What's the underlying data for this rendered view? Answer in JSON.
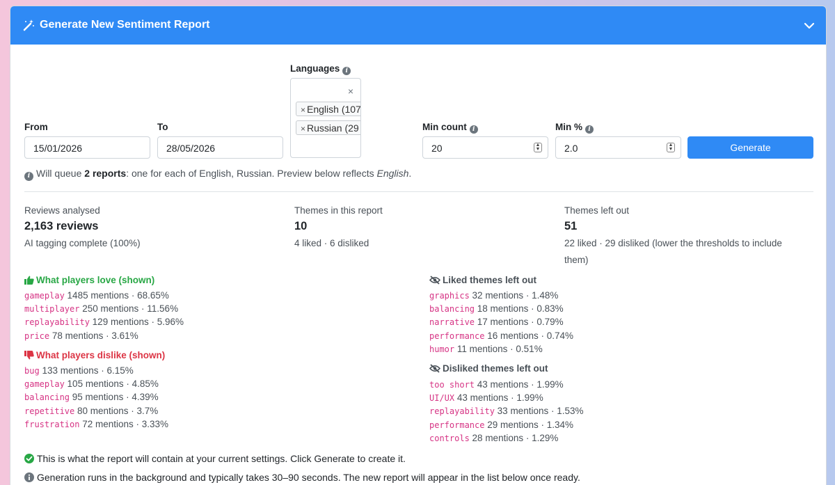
{
  "header": {
    "title": "Generate New Sentiment Report"
  },
  "form": {
    "from_label": "From",
    "from_value": "15/01/2026",
    "to_label": "To",
    "to_value": "28/05/2026",
    "languages_label": "Languages",
    "languages": [
      "English (107",
      "Russian (29"
    ],
    "min_count_label": "Min count",
    "min_count_value": "20",
    "min_pct_label": "Min %",
    "min_pct_value": "2.0",
    "generate_label": "Generate"
  },
  "queue_note": {
    "prefix": "Will queue ",
    "bold": "2 reports",
    "middle": ": one for each of English, Russian. Preview below reflects ",
    "italic": "English",
    "suffix": "."
  },
  "stats": {
    "reviews": {
      "label": "Reviews analysed",
      "value": "2,163 reviews",
      "sub": "AI tagging complete (100%)"
    },
    "themes": {
      "label": "Themes in this report",
      "value": "10",
      "sub": "4 liked · 6 disliked"
    },
    "left_out": {
      "label": "Themes left out",
      "value": "51",
      "sub": "22 liked · 29 disliked (lower the thresholds to include them)"
    }
  },
  "sections": {
    "love_title": "What players love (shown)",
    "love": [
      {
        "theme": "gameplay",
        "stats": " 1485 mentions · 68.65%"
      },
      {
        "theme": "multiplayer",
        "stats": " 250 mentions · 11.56%"
      },
      {
        "theme": "replayability",
        "stats": " 129 mentions · 5.96%"
      },
      {
        "theme": "price",
        "stats": " 78 mentions · 3.61%"
      }
    ],
    "dislike_title": "What players dislike (shown)",
    "dislike": [
      {
        "theme": "bug",
        "stats": " 133 mentions · 6.15%"
      },
      {
        "theme": "gameplay",
        "stats": " 105 mentions · 4.85%"
      },
      {
        "theme": "balancing",
        "stats": " 95 mentions · 4.39%"
      },
      {
        "theme": "repetitive",
        "stats": " 80 mentions · 3.7%"
      },
      {
        "theme": "frustration",
        "stats": " 72 mentions · 3.33%"
      }
    ],
    "liked_out_title": "Liked themes left out",
    "liked_out": [
      {
        "theme": "graphics",
        "stats": " 32 mentions · 1.48%"
      },
      {
        "theme": "balancing",
        "stats": " 18 mentions · 0.83%"
      },
      {
        "theme": "narrative",
        "stats": " 17 mentions · 0.79%"
      },
      {
        "theme": "performance",
        "stats": " 16 mentions · 0.74%"
      },
      {
        "theme": "humor",
        "stats": " 11 mentions · 0.51%"
      }
    ],
    "disliked_out_title": "Disliked themes left out",
    "disliked_out": [
      {
        "theme": "too short",
        "stats": " 43 mentions · 1.99%"
      },
      {
        "theme": "UI/UX",
        "stats": " 43 mentions · 1.99%"
      },
      {
        "theme": "replayability",
        "stats": " 33 mentions · 1.53%"
      },
      {
        "theme": "performance",
        "stats": " 29 mentions · 1.34%"
      },
      {
        "theme": "controls",
        "stats": " 28 mentions · 1.29%"
      }
    ]
  },
  "footer": {
    "preview_note": "This is what the report will contain at your current settings. Click Generate to create it.",
    "timing_note": "Generation runs in the background and typically takes 30–90 seconds. The new report will appear in the list below once ready."
  },
  "colors": {
    "primary": "#2f8af5",
    "success": "#28a745",
    "danger": "#dc3545",
    "code": "#d63384"
  }
}
